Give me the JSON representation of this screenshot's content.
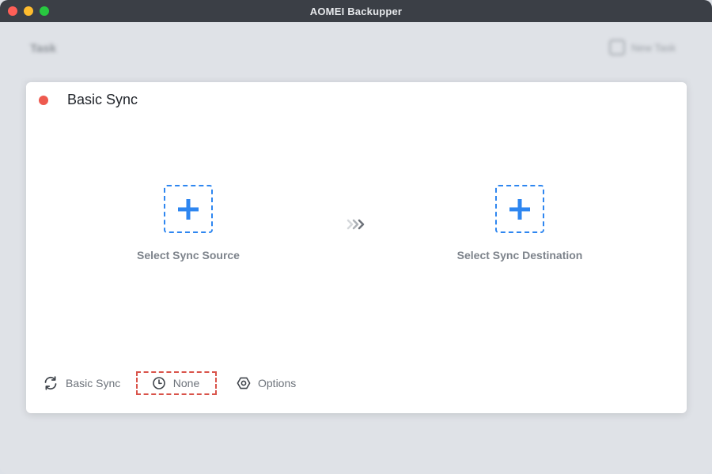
{
  "window": {
    "title": "AOMEI Backupper"
  },
  "background": {
    "page_title": "Task",
    "new_task_label": "New Task"
  },
  "dialog": {
    "title": "Basic Sync",
    "status_color": "#ee5a4f",
    "source": {
      "label": "Select Sync Source",
      "icon": "plus-icon"
    },
    "destination": {
      "label": "Select Sync Destination",
      "icon": "plus-icon"
    },
    "flow_icon": "triple-chevron-right-icon",
    "footer": {
      "sync_mode": {
        "label": "Basic Sync",
        "icon": "sync-icon"
      },
      "schedule": {
        "label": "None",
        "icon": "clock-icon",
        "highlight_color": "#d9534a"
      },
      "options": {
        "label": "Options",
        "icon": "gear-icon"
      }
    }
  },
  "colors": {
    "accent": "#2e86f0",
    "titlebar": "#3b3f46"
  }
}
